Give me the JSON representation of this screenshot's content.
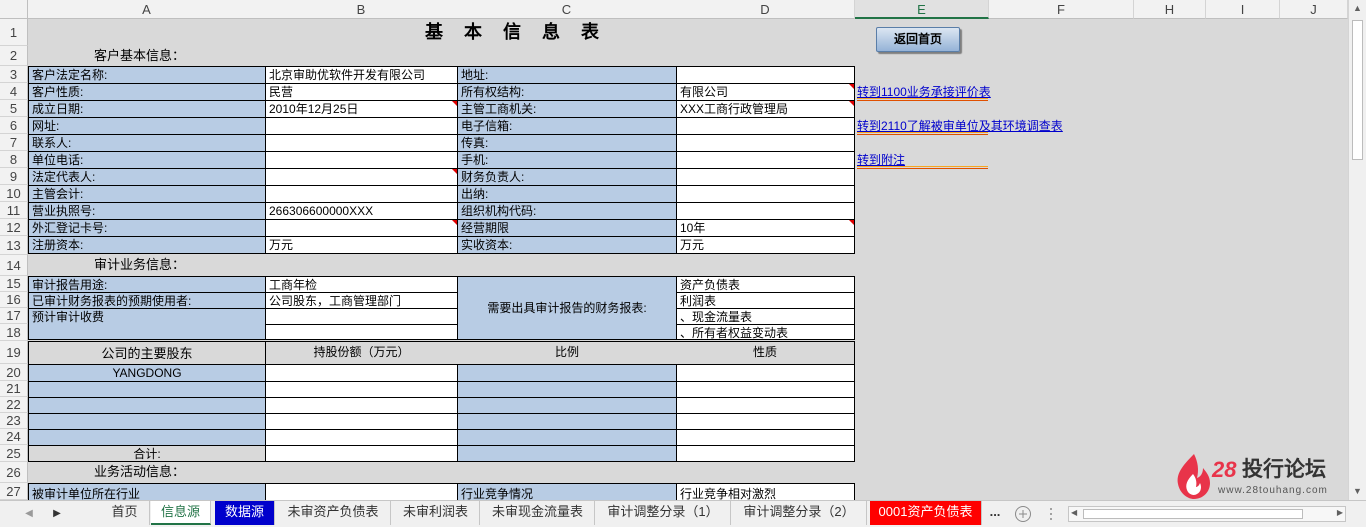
{
  "columns": [
    "A",
    "B",
    "C",
    "D",
    "E",
    "F",
    "H",
    "I",
    "J"
  ],
  "rows": [
    "1",
    "2",
    "3",
    "4",
    "5",
    "6",
    "7",
    "8",
    "9",
    "10",
    "11",
    "12",
    "13",
    "14",
    "15",
    "16",
    "17",
    "18",
    "19",
    "20",
    "21",
    "22",
    "23",
    "24",
    "25",
    "26",
    "27"
  ],
  "title": "基 本 信 息 表",
  "back_button": "返回首页",
  "sections": {
    "customer": "客户基本信息：",
    "audit": "审计业务信息：",
    "business": "业务活动信息："
  },
  "customer_info": {
    "legal_name_label": "客户法定名称:",
    "legal_name": "北京审助优软件开发有限公司",
    "address_label": "地址:",
    "address": "",
    "nature_label": "客户性质:",
    "nature": "民营",
    "ownership_label": "所有权结构:",
    "ownership": "有限公司",
    "founded_label": "成立日期:",
    "founded": "2010年12月25日",
    "authority_label": "主管工商机关:",
    "authority": "XXX工商行政管理局",
    "website_label": "网址:",
    "email_label": "电子信箱:",
    "contact_label": "联系人:",
    "fax_label": "传真:",
    "phone_label": "单位电话:",
    "mobile_label": "手机:",
    "rep_label": "法定代表人:",
    "finance_head_label": "财务负责人:",
    "accountant_label": "主管会计:",
    "cashier_label": "出纳:",
    "license_label": "营业执照号:",
    "license": "266306600000XXX",
    "org_code_label": "组织机构代码:",
    "forex_label": "外汇登记卡号:",
    "term_label": "经营期限",
    "term": "10年",
    "reg_capital_label": "注册资本:",
    "reg_capital": "万元",
    "paid_capital_label": "实收资本:",
    "paid_capital": "万元"
  },
  "audit_info": {
    "purpose_label": "审计报告用途:",
    "purpose": "工商年检",
    "users_label": "已审计财务报表的预期使用者:",
    "users": "公司股东，工商管理部门",
    "fee_label": "预计审计收费",
    "statements_label": "需要出具审计报告的财务报表:",
    "statements": [
      "资产负债表",
      "利润表",
      "、现金流量表",
      "、所有者权益变动表"
    ]
  },
  "shareholders": {
    "header": "公司的主要股东",
    "col_amount": "持股份额（万元）",
    "col_ratio": "比例",
    "col_nature": "性质",
    "names": [
      "YANGDONG",
      "",
      "",
      "",
      ""
    ],
    "total_label": "合计:"
  },
  "business_info": {
    "location_label": "被审计单位所在行业",
    "competition_label": "行业竞争情况",
    "competition": "行业竞争相对激烈"
  },
  "links": [
    "转到1100业务承接评价表",
    "转到2110了解被审单位及其环境调查表",
    "转到附注"
  ],
  "tabs": [
    "首页",
    "信息源",
    "数据源",
    "未审资产负债表",
    "未审利润表",
    "未审现金流量表",
    "审计调整分录（1）",
    "审计调整分录（2）",
    "0001资产负债表"
  ],
  "tabs_more": "...",
  "watermark": {
    "number": "28",
    "name": "投行论坛",
    "url": "www.28touhang.com"
  },
  "colors": {
    "label_fill": "#b8cce4",
    "tab_blue": "#0000cc",
    "tab_red": "#ff0000",
    "accent": "#217346"
  }
}
